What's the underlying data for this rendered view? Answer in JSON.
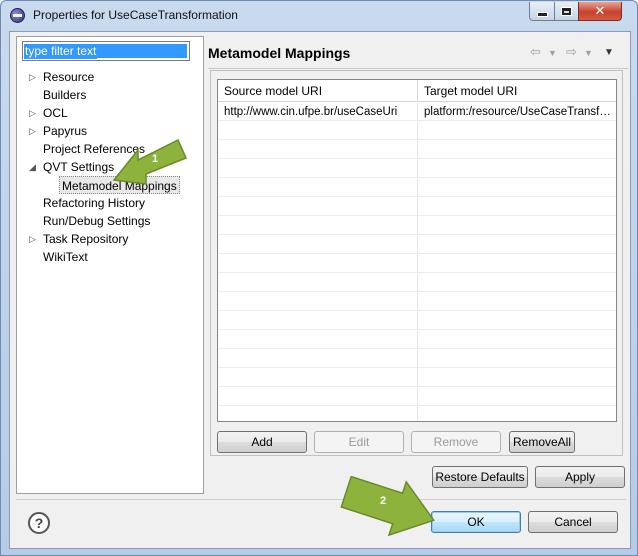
{
  "window": {
    "title": "Properties for UseCaseTransformation",
    "close_glyph": "✕"
  },
  "filter": {
    "placeholder": "type filter text",
    "value": "type filter text"
  },
  "tree": {
    "items": [
      {
        "label": "Resource",
        "expandable": true
      },
      {
        "label": "Builders",
        "expandable": false
      },
      {
        "label": "OCL",
        "expandable": true
      },
      {
        "label": "Papyrus",
        "expandable": true
      },
      {
        "label": "Project References",
        "expandable": false
      },
      {
        "label": "QVT Settings",
        "expandable": true,
        "expanded": true
      },
      {
        "label": "Metamodel Mappings",
        "expandable": false,
        "selected": true,
        "child": true
      },
      {
        "label": "Refactoring History",
        "expandable": false
      },
      {
        "label": "Run/Debug Settings",
        "expandable": false
      },
      {
        "label": "Task Repository",
        "expandable": true
      },
      {
        "label": "WikiText",
        "expandable": false
      }
    ]
  },
  "page": {
    "title": "Metamodel Mappings"
  },
  "table": {
    "columns": [
      "Source model URI",
      "Target model URI"
    ],
    "rows": [
      [
        "http://www.cin.ufpe.br/useCaseUri",
        "platform:/resource/UseCaseTransformation"
      ]
    ]
  },
  "table_buttons": {
    "add": "Add",
    "edit": "Edit",
    "remove": "Remove",
    "remove_all": "RemoveAll"
  },
  "page_buttons": {
    "restore_defaults": "Restore Defaults",
    "apply": "Apply"
  },
  "dialog_buttons": {
    "ok": "OK",
    "cancel": "Cancel",
    "help": "?"
  },
  "annotations": {
    "arrow1_label": "1",
    "arrow2_label": "2",
    "arrow_color": "#8db33c"
  },
  "colors": {
    "selection": "#3399ff",
    "close_button": "#c7412b"
  }
}
